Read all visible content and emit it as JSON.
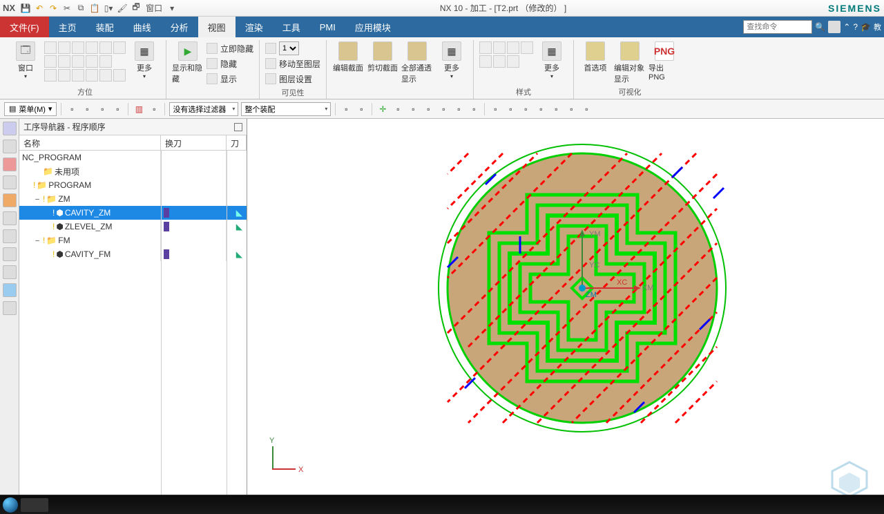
{
  "titlebar": {
    "app": "NX",
    "titleCenter": "NX 10 - 加工 - [T2.prt （修改的） ]",
    "brand": "SIEMENS",
    "windowMenu": "窗口"
  },
  "menu": {
    "file": "文件(F)",
    "tabs": [
      "主页",
      "装配",
      "曲线",
      "分析",
      "视图",
      "渲染",
      "工具",
      "PMI",
      "应用模块"
    ],
    "activeTab": "视图",
    "searchPlaceholder": "查找命令",
    "teach": "教"
  },
  "ribbon": {
    "g1": {
      "btn": "窗口",
      "more": "更多",
      "label": "方位"
    },
    "g2": {
      "btn": "显示和隐藏",
      "label": ""
    },
    "g3": {
      "r1": "立即隐藏",
      "r2": "隐藏",
      "r3": "显示",
      "label": ""
    },
    "g4": {
      "selectVal": "1",
      "r1": "移动至图层",
      "r2": "图层设置",
      "label": "可见性"
    },
    "g5": {
      "b1": "编辑截面",
      "b2": "剪切截面",
      "b3": "全部通透显示",
      "more": "更多",
      "label": ""
    },
    "g6": {
      "more": "更多",
      "label": "样式"
    },
    "g7": {
      "b1": "首选项",
      "b2": "编辑对象显示",
      "b3": "导出 PNG",
      "png": "PNG",
      "label": "可视化"
    }
  },
  "toolbar2": {
    "menuBtn": "菜单(M)",
    "filter1": "没有选择过滤器",
    "filter2": "整个装配"
  },
  "nav": {
    "title": "工序导航器 - 程序顺序",
    "cols": {
      "c1": "名称",
      "c2": "换刀",
      "c3": "刀"
    }
  },
  "tree": {
    "root": "NC_PROGRAM",
    "unused": "未用项",
    "program": "PROGRAM",
    "zm": "ZM",
    "cavity_zm": "CAVITY_ZM",
    "zlevel_zm": "ZLEVEL_ZM",
    "fm": "FM",
    "cavity_fm": "CAVITY_FM"
  },
  "axes": {
    "x": "X",
    "y": "Y",
    "xc": "XC",
    "yc": "YC",
    "xm": "XM",
    "ym": "YM",
    "zm": "ZM"
  }
}
